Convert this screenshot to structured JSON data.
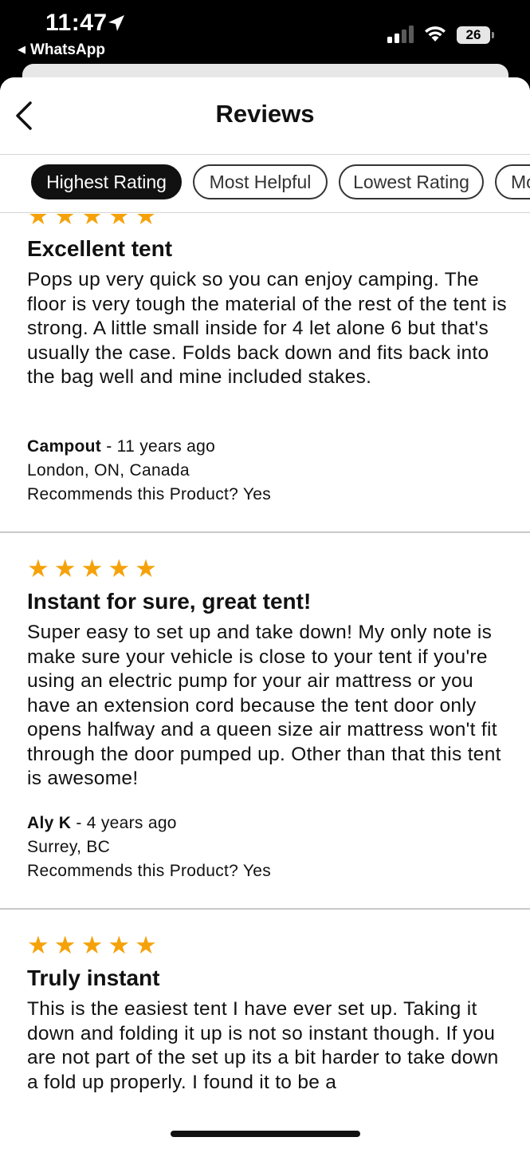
{
  "status_bar": {
    "time": "11:47",
    "back_app": "WhatsApp",
    "battery": "26"
  },
  "header": {
    "title": "Reviews"
  },
  "filters": [
    {
      "label": "Highest Rating",
      "active": true
    },
    {
      "label": "Most Helpful",
      "active": false
    },
    {
      "label": "Lowest Rating",
      "active": false
    },
    {
      "label": "Mo",
      "active": false
    }
  ],
  "reviews": [
    {
      "stars": "★★★★★",
      "rating": 5,
      "title": "Excellent tent",
      "body": "Pops up very quick so you can enjoy camping. The floor is very tough the material of the rest of the tent is strong. A little small inside for 4 let alone 6 but that's usually the case. Folds back down and fits back into the bag well and mine included stakes.",
      "author": "Campout",
      "age": " - 11 years ago",
      "location": "London, ON, Canada",
      "recommends": "Recommends this Product? Yes"
    },
    {
      "stars": "★★★★★",
      "rating": 5,
      "title": "Instant for sure, great tent!",
      "body": "Super easy to set up and take down! My only note is make sure your vehicle is close to your tent if you're using an electric pump for your air mattress or you have an extension cord because the tent door only opens halfway and a queen size air mattress won't fit through the door pumped up. Other than that this tent is awesome!",
      "author": "Aly K",
      "age": " - 4 years ago",
      "location": "Surrey, BC",
      "recommends": "Recommends this Product? Yes"
    },
    {
      "stars": "★★★★★",
      "rating": 5,
      "title": "Truly instant",
      "body": "This is the easiest tent I have ever set up. Taking it down and folding it up is not so instant though. If you are not part of the set up its a bit harder to take down a fold up properly. I found it to be a"
    }
  ],
  "colors": {
    "star": "#f5a20a",
    "chip_active_bg": "#111111",
    "divider": "#c9c9c9"
  }
}
